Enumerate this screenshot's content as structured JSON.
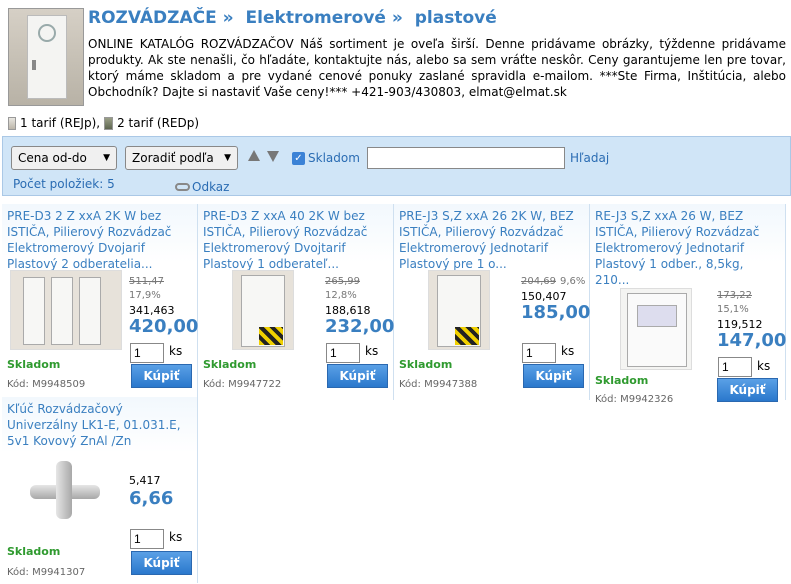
{
  "header": {
    "breadcrumb": [
      "ROZVÁDZAČE »",
      "Elektromerové »",
      "plastové"
    ],
    "description": "ONLINE KATALÓG ROZVÁDZAČOV Náš sortiment je oveľa širší. Denne pridávame obrázky, týždenne pridávame produkty. Ak ste nenašli, čo hľadáte, kontaktujte nás, alebo sa sem vráťte neskôr. Ceny garantujeme len pre tovar, ktorý máme skladom a pre vydané cenové ponuky zaslané spravidla e-mailom. ***Ste Firma, Inštitúcia, alebo Obchodník? Dajte si nastaviť Vaše ceny!*** +421-903/430803, elmat@elmat.sk"
  },
  "legend": {
    "item1": "1 tarif (REJp),",
    "item2": "2 tarif (REDp)"
  },
  "filter": {
    "price_select": "Cena od-do",
    "sort_select": "Zoradiť podľa",
    "stock_label": "Skladom",
    "search_value": "",
    "search_button": "Hľadaj",
    "count_label": "Počet položiek:",
    "count_value": "5",
    "link_label": "Odkaz"
  },
  "products": [
    {
      "name": "PRE-D3 2 Z xxA 2K W bez ISTIČA, Pilierový Rozvádzač Elektromerový Dvojarif Plastový 2 odberatelia...",
      "old_price": "511,47",
      "discount": "17,9%",
      "base_price": "341,463",
      "price": "420,00",
      "stock": "Skladom",
      "qty": "1",
      "unit": "ks",
      "buy": "Kúpiť",
      "code": "Kód: M9948509"
    },
    {
      "name": "PRE-D3 Z xxA 40 2K W bez ISTIČA, Pilierový Rozvádzač Elektromerový Dvojtarif Plastový 1 odberateľ...",
      "old_price": "265,99",
      "discount": "12,8%",
      "base_price": "188,618",
      "price": "232,00",
      "stock": "Skladom",
      "qty": "1",
      "unit": "ks",
      "buy": "Kúpiť",
      "code": "Kód: M9947722"
    },
    {
      "name": "PRE-J3 S,Z xxA 26 2K W, BEZ ISTIČA, Pilierový Rozvádzač Elektromerový Jednotarif Plastový pre 1 o...",
      "old_price": "204,69",
      "discount": "9,6%",
      "base_price": "150,407",
      "price": "185,00",
      "stock": "Skladom",
      "qty": "1",
      "unit": "ks",
      "buy": "Kúpiť",
      "code": "Kód: M9947388"
    },
    {
      "name": "RE-J3 S,Z xxA 26 W, BEZ ISTIČA, Pilierový Rozvádzač Elektromerový Jednotarif Plastový 1 odber., 8,5kg, 210...",
      "old_price": "173,22",
      "discount": "15,1%",
      "base_price": "119,512",
      "price": "147,00",
      "stock": "Skladom",
      "qty": "1",
      "unit": "ks",
      "buy": "Kúpiť",
      "code": "Kód: M9942326"
    },
    {
      "name": "Kľúč Rozvádzačový Univerzálny LK1-E, 01.031.E, 5v1 Kovový ZnAl /Zn",
      "old_price": "",
      "discount": "",
      "base_price": "5,417",
      "price": "6,66",
      "stock": "Skladom",
      "qty": "1",
      "unit": "ks",
      "buy": "Kúpiť",
      "code": "Kód: M9941307"
    }
  ]
}
